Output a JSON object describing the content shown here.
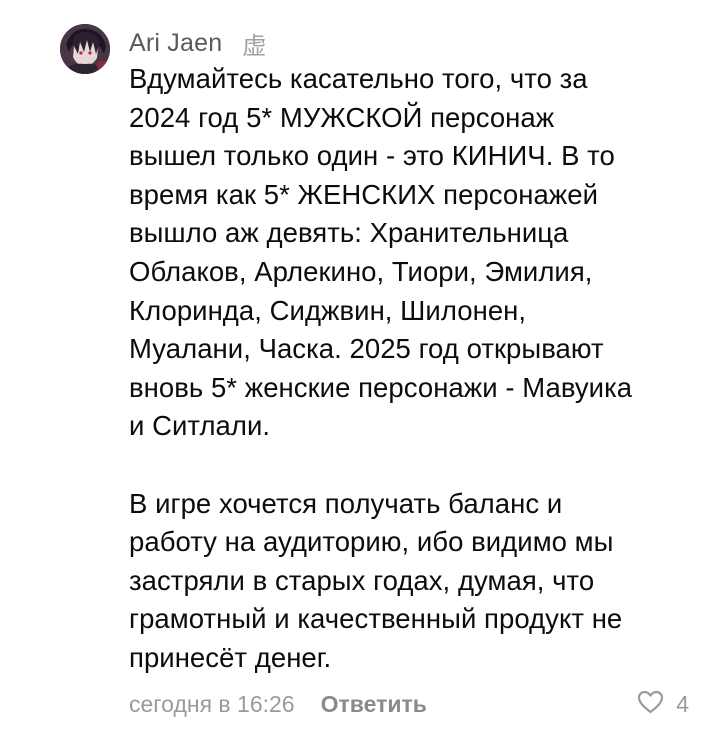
{
  "comment": {
    "author": "Ari Jaen",
    "badge": "虚",
    "paragraphs": [
      "Вдумайтесь касательно того, что за\n2024 год 5* МУЖСКОЙ персонаж\nвышел только один - это КИНИЧ. В то\nвремя как 5* ЖЕНСКИХ персонажей\nвышло аж девять: Хранительница\nОблаков, Арлекино, Тиори, Эмилия,\nКлоринда, Сиджвин, Шилонен,\nМуалани, Часка. 2025 год открывают\nвновь 5* женские персонажи - Мавуика\nи Ситлали.",
      "В игре хочется получать баланс и\nработу на аудиторию, ибо видимо мы\nзастряли в старых годах, думая, что\nграмотный и качественный продукт не\nпринесёт денег."
    ],
    "timestamp": "сегодня в 16:26",
    "reply_label": "Ответить",
    "likes": "4",
    "icons": {
      "avatar": "user-avatar",
      "like": "heart-icon"
    },
    "colors": {
      "author": "#5a5a5a",
      "meta": "#9a9a9a",
      "body": "#0c0c0c"
    }
  }
}
